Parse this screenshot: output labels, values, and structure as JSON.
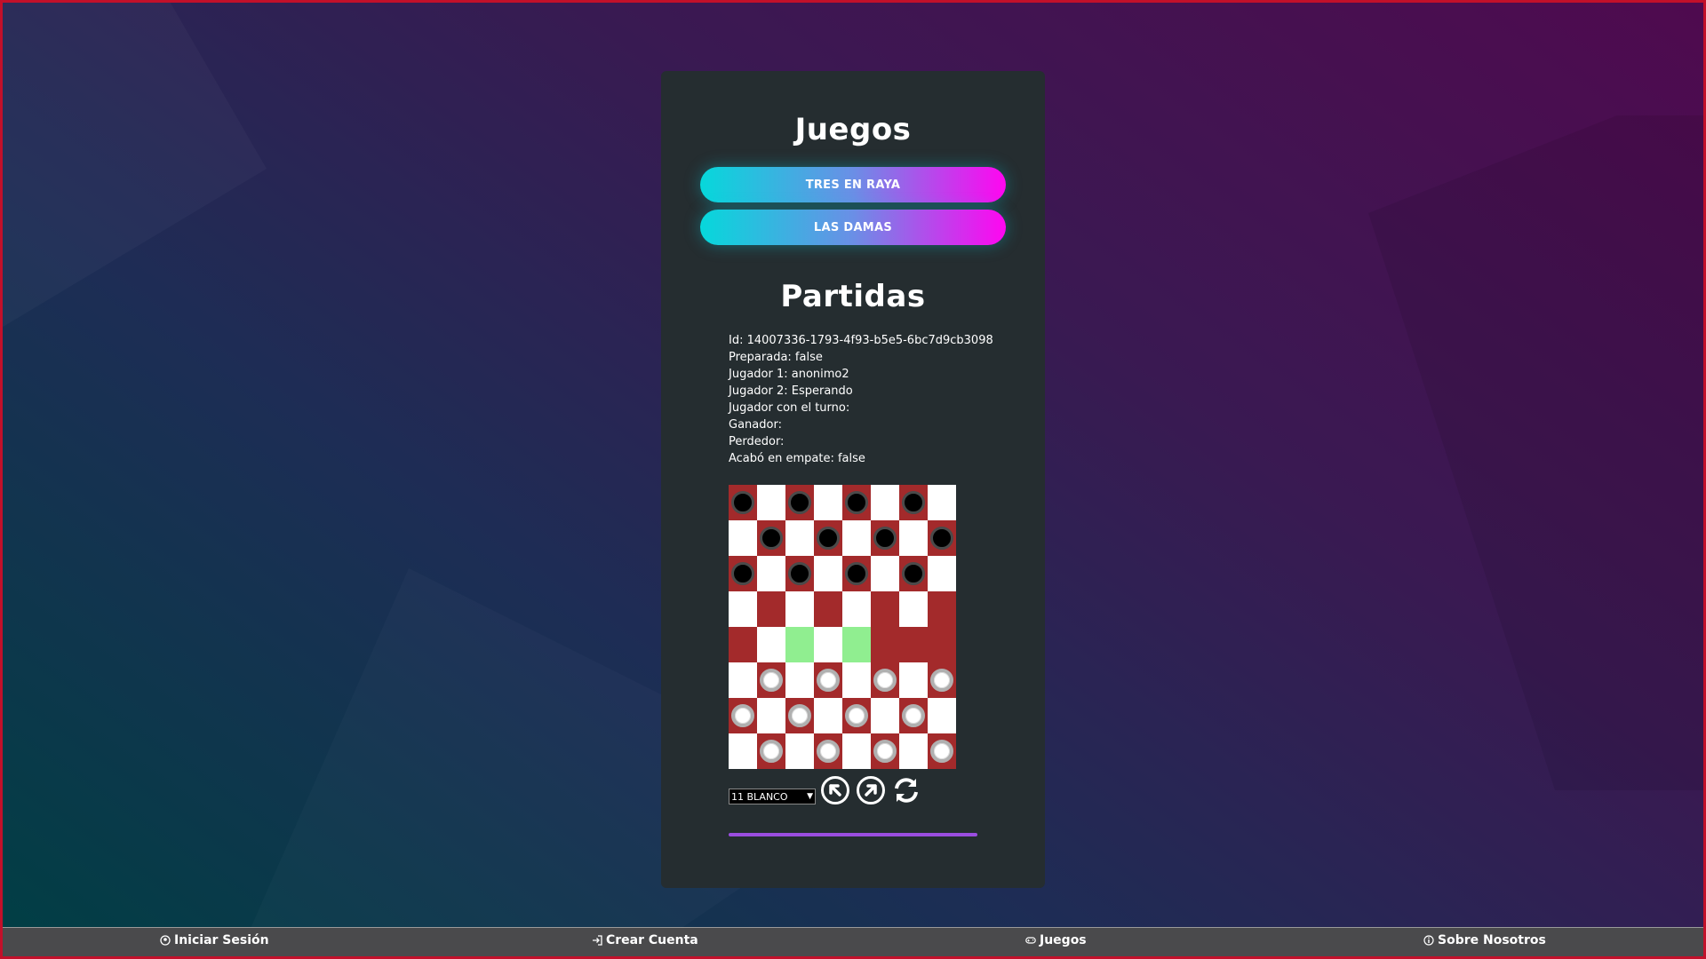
{
  "games_section": {
    "title": "Juegos",
    "buttons": [
      "TRES EN RAYA",
      "LAS DAMAS"
    ]
  },
  "matches_section": {
    "title": "Partidas",
    "info": [
      "Id: 14007336-1793-4f93-b5e5-6bc7d9cb3098",
      "Preparada: false",
      "Jugador 1: anonimo2",
      "Jugador 2: Esperando",
      "Jugador con el turno:",
      "Ganador:",
      "Perdedor:",
      "Acabó en empate: false"
    ]
  },
  "board": {
    "rows": [
      "BLBLBLBL",
      "LBLBLBLB",
      "BLBLBLBL",
      "L.L.L.L.",
      ".LHLH...",
      "LWLWLWLW",
      "WLWLWLWL",
      "LWLWLWLW"
    ],
    "legend": {
      "B": "black piece on dark square",
      "W": "white piece on dark square",
      "L": "light square",
      ".": "empty dark square",
      "H": "highlighted square"
    },
    "colors": {
      "dark": "#a32a2b",
      "light": "#ffffff",
      "highlight": "#90ee90"
    }
  },
  "controls": {
    "select_value": "11 BLANCO",
    "icons": [
      "arrow-up-left-circle-icon",
      "arrow-up-right-circle-icon",
      "refresh-icon"
    ]
  },
  "footer": {
    "items": [
      {
        "label": "Iniciar Sesión",
        "icon": "user-circle-icon"
      },
      {
        "label": "Crear Cuenta",
        "icon": "sign-in-icon"
      },
      {
        "label": "Juegos",
        "icon": "gamepad-icon"
      },
      {
        "label": "Sobre Nosotros",
        "icon": "info-circle-icon"
      }
    ]
  },
  "colors": {
    "accent_gradient_start": "#06d8db",
    "accent_gradient_end": "#ff06f0",
    "card_bg": "#252d30",
    "divider": "#9b4de0",
    "footer_bg": "#4a4a4c"
  }
}
